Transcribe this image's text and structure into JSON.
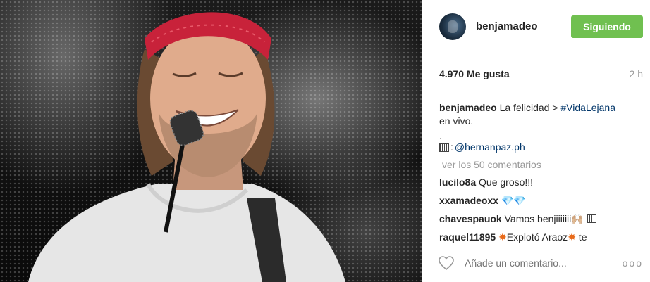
{
  "post": {
    "username": "benjamadeo",
    "follow_label": "Siguiendo",
    "likes": "4.970 Me gusta",
    "time_ago": "2 h",
    "caption_user": "benjamadeo",
    "caption_text": "La felicidad > ",
    "caption_hashtag": "#VidaLejana",
    "caption_text2": "en vivo.",
    "caption_dot": ".",
    "credit_sep": ": ",
    "credit_link": "@hernanpaz.ph",
    "view_all": "ver los 50 comentarios",
    "add_comment_placeholder": "Añade un comentario...",
    "more_label": "ooo"
  },
  "comments": [
    {
      "user": "lucilo8a",
      "text": "Que groso!!!"
    },
    {
      "user": "xxamadeoxx",
      "text": "💎💎"
    },
    {
      "user": "chavespauok",
      "text": "Vamos benjiiiiiii🙌🏼"
    },
    {
      "user": "raquel11895",
      "text": "Explotó Araoz",
      "tail": " te"
    }
  ],
  "icons": {
    "heart": "heart-outline-icon",
    "more": "more-options-icon"
  },
  "colors": {
    "follow_button": "#70c050",
    "link": "#003569",
    "bandana": "#c8223a"
  }
}
